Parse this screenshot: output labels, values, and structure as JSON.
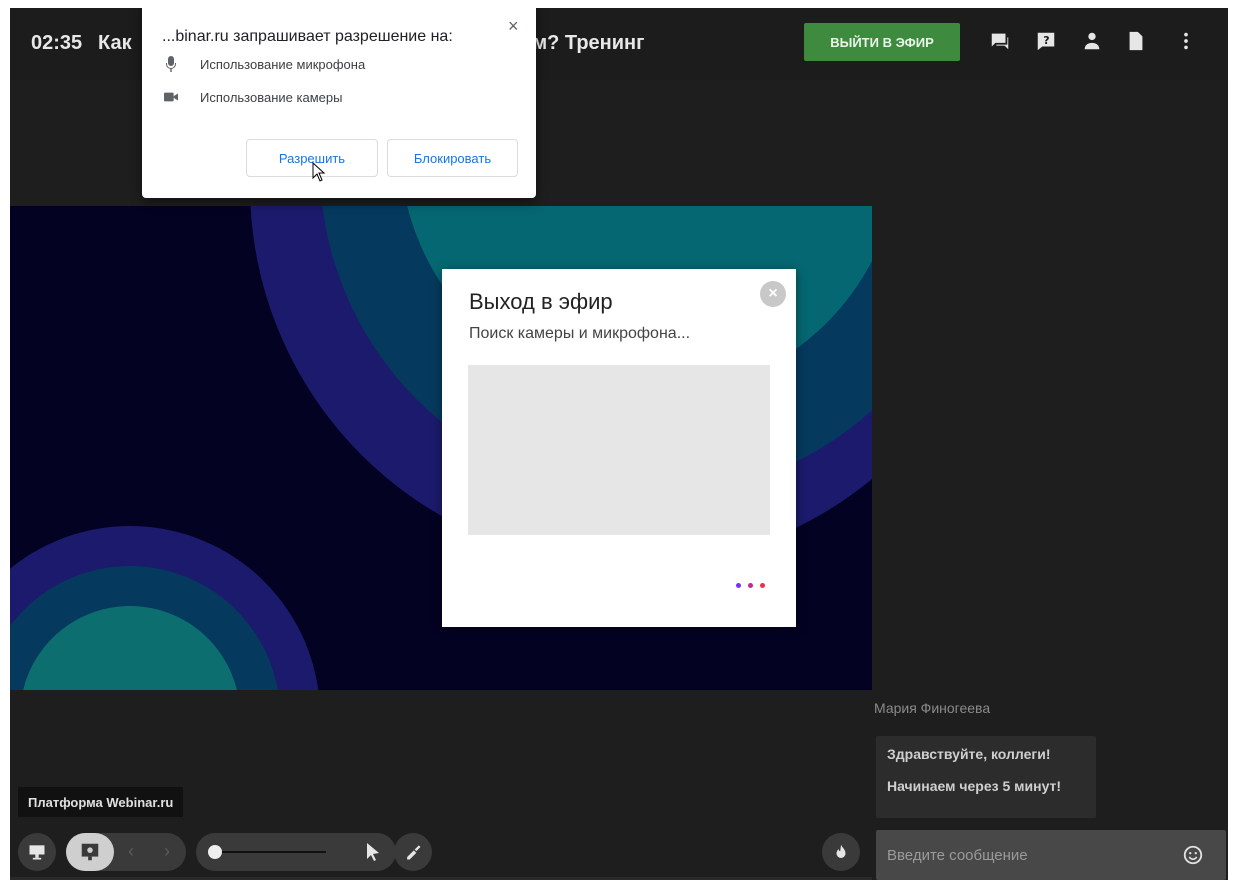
{
  "topbar": {
    "time": "02:35",
    "title": "Как                                                                  иком? Тренинг",
    "golive_label": "ВЫЙТИ В ЭФИР",
    "icons": [
      "chat-icon",
      "question-icon",
      "participants-icon",
      "document-icon",
      "more-vert-icon"
    ]
  },
  "permission": {
    "title": "...binar.ru запрашивает разрешение на:",
    "close": "×",
    "items": [
      {
        "icon": "microphone-icon",
        "label": "Использование микрофона"
      },
      {
        "icon": "camera-icon",
        "label": "Использование камеры"
      }
    ],
    "allow_label": "Разрешить",
    "block_label": "Блокировать"
  },
  "modal": {
    "title": "Выход в эфир",
    "subtitle": "Поиск камеры и микрофона...",
    "close": "×",
    "loader_colors": [
      "#7b2ff7",
      "#c2298a",
      "#e8334a"
    ]
  },
  "chat": {
    "author": "Мария Финогеева",
    "messages": [
      "Здравствуйте, коллеги!",
      "Начинаем через 5 минут!"
    ],
    "input_placeholder": "Введите сообщение",
    "emoji_icon": "smiley-icon"
  },
  "toolbar": {
    "platform_label": "Платформа Webinar.ru",
    "prev": "‹",
    "next": "›",
    "zoom_level": 0.0,
    "tools": [
      "screen-share-icon",
      "presentation-icon",
      "pointer-icon",
      "clear-icon",
      "fire-icon"
    ]
  },
  "colors": {
    "accent_green": "#3e8a3f",
    "stage_bg": "#040222",
    "link_blue": "#1a73e8"
  }
}
